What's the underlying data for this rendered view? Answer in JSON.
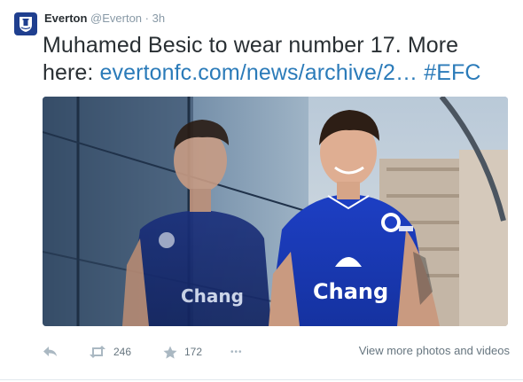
{
  "author": {
    "name": "Everton",
    "handle": "@Everton",
    "separator": "·",
    "time": "3h"
  },
  "tweet": {
    "text_plain": "Muhamed Besic to wear number 17. More here: ",
    "link": "evertonfc.com/news/archive/2…",
    "space": " ",
    "hashtag": "#EFC"
  },
  "photo": {
    "shirt_sponsor": "Chang",
    "reflection_sponsor": "Chang"
  },
  "actions": {
    "retweet_count": "246",
    "favorite_count": "172",
    "more_glyph": "•••",
    "view_more_label": "View more photos and videos"
  },
  "colors": {
    "link": "#2b7bb9",
    "text": "#292f33",
    "muted": "#8899a6",
    "everton_blue": "#1f3f8f"
  }
}
